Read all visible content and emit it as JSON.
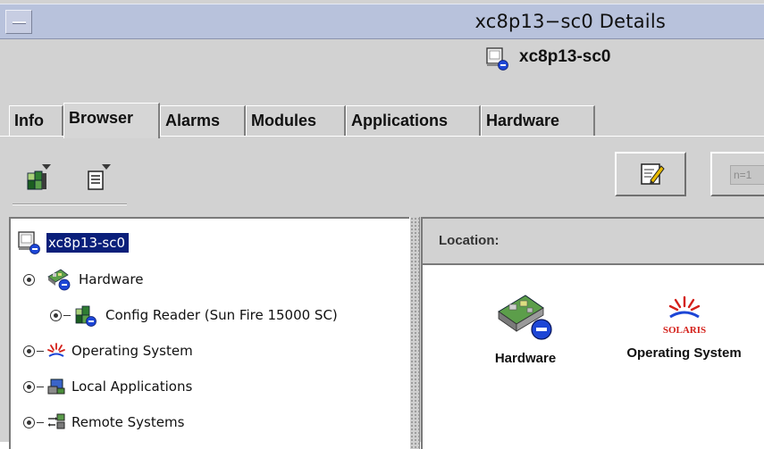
{
  "window": {
    "title": "xc8p13−sc0 Details",
    "menu_icon": "window-menu-icon"
  },
  "host_header": {
    "name": "xc8p13-sc0",
    "icon": "server-icon"
  },
  "tabs": [
    {
      "label": "Info",
      "active": false
    },
    {
      "label": "Browser",
      "active": true
    },
    {
      "label": "Alarms",
      "active": false
    },
    {
      "label": "Modules",
      "active": false
    },
    {
      "label": "Applications",
      "active": false
    },
    {
      "label": "Hardware",
      "active": false
    }
  ],
  "toolbar": {
    "left_icons": [
      "module-browser-dropdown-icon",
      "document-dropdown-icon"
    ],
    "edit_icon": "edit-notepad-icon",
    "counter_label": "n=1"
  },
  "tree": {
    "root": {
      "label": "xc8p13-sc0",
      "selected": true,
      "icon": "server-icon"
    },
    "items": [
      {
        "label": "Hardware",
        "icon": "hardware-board-icon",
        "expanded": true
      },
      {
        "label": "Config Reader (Sun Fire 15000 SC)",
        "icon": "config-reader-icon",
        "expanded": false
      },
      {
        "label": "Operating System",
        "icon": "solaris-sun-icon",
        "expanded": false
      },
      {
        "label": "Local Applications",
        "icon": "applications-icon",
        "expanded": false
      },
      {
        "label": "Remote Systems",
        "icon": "remote-systems-icon",
        "expanded": false
      }
    ]
  },
  "details": {
    "location_label": "Location:",
    "items": [
      {
        "label": "Hardware",
        "icon": "hardware-board-icon"
      },
      {
        "label": "Operating System",
        "icon": "solaris-logo-icon",
        "logo_text": "SOLARIS"
      }
    ]
  },
  "colors": {
    "titlebar": "#b8c2dc",
    "selection": "#0a1f7a",
    "panel": "#d2d2d2",
    "solaris_red": "#d4201a"
  }
}
